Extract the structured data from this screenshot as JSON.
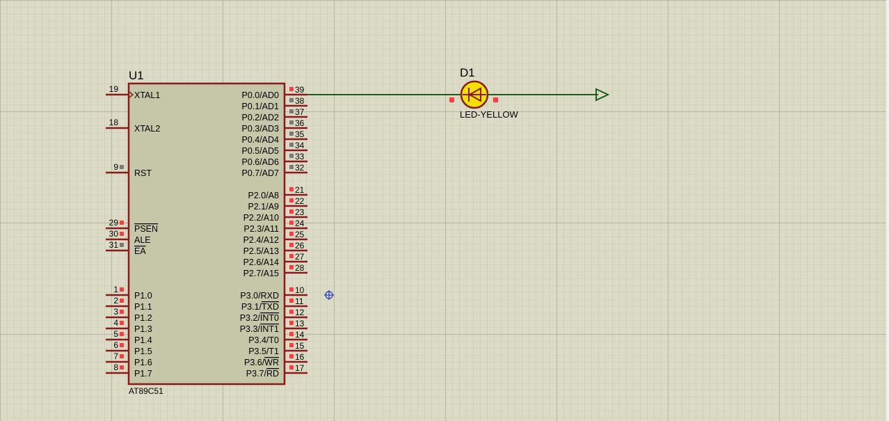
{
  "colors": {
    "background": "#dcdcc6",
    "grid_minor": "#c9c9b6",
    "grid_major": "#b9b9a8",
    "chip_fill": "#c6c6a8",
    "chip_outline": "#8b1a1a",
    "pin_line": "#8b1a1a",
    "wire": "#1e5c1e",
    "pin_marker_red": "#ff3b3b",
    "pin_marker_grey": "#7a7a7a",
    "led_fill": "#f5e100",
    "text": "#000000",
    "origin_marker": "#2233cc"
  },
  "schematic": {
    "u1": {
      "ref": "U1",
      "part": "AT89C51",
      "left_pins": [
        {
          "num": "19",
          "name": "XTAL1",
          "clock": true,
          "marker": "none"
        },
        {
          "num": "18",
          "name": "XTAL2",
          "marker": "none"
        },
        {
          "num": "9",
          "name": "RST",
          "marker": "grey"
        },
        {
          "num": "29",
          "name": "PSEN",
          "overline": true,
          "marker": "red"
        },
        {
          "num": "30",
          "name": "ALE",
          "marker": "red"
        },
        {
          "num": "31",
          "name": "EA",
          "overline": true,
          "marker": "grey"
        },
        {
          "num": "1",
          "name": "P1.0",
          "marker": "red"
        },
        {
          "num": "2",
          "name": "P1.1",
          "marker": "red"
        },
        {
          "num": "3",
          "name": "P1.2",
          "marker": "red"
        },
        {
          "num": "4",
          "name": "P1.3",
          "marker": "red"
        },
        {
          "num": "5",
          "name": "P1.4",
          "marker": "red"
        },
        {
          "num": "6",
          "name": "P1.5",
          "marker": "red"
        },
        {
          "num": "7",
          "name": "P1.6",
          "marker": "red"
        },
        {
          "num": "8",
          "name": "P1.7",
          "marker": "red"
        }
      ],
      "right_pins": [
        {
          "num": "39",
          "name": "P0.0/AD0",
          "marker": "red"
        },
        {
          "num": "38",
          "name": "P0.1/AD1",
          "marker": "grey"
        },
        {
          "num": "37",
          "name": "P0.2/AD2",
          "marker": "grey"
        },
        {
          "num": "36",
          "name": "P0.3/AD3",
          "marker": "grey"
        },
        {
          "num": "35",
          "name": "P0.4/AD4",
          "marker": "grey"
        },
        {
          "num": "34",
          "name": "P0.5/AD5",
          "marker": "grey"
        },
        {
          "num": "33",
          "name": "P0.6/AD6",
          "marker": "grey"
        },
        {
          "num": "32",
          "name": "P0.7/AD7",
          "marker": "grey"
        },
        {
          "num": "21",
          "name": "P2.0/A8",
          "marker": "red"
        },
        {
          "num": "22",
          "name": "P2.1/A9",
          "marker": "red"
        },
        {
          "num": "23",
          "name": "P2.2/A10",
          "marker": "red"
        },
        {
          "num": "24",
          "name": "P2.3/A11",
          "marker": "red"
        },
        {
          "num": "25",
          "name": "P2.4/A12",
          "marker": "red"
        },
        {
          "num": "26",
          "name": "P2.5/A13",
          "marker": "red"
        },
        {
          "num": "27",
          "name": "P2.6/A14",
          "marker": "red"
        },
        {
          "num": "28",
          "name": "P2.7/A15",
          "marker": "red"
        },
        {
          "num": "10",
          "name": "P3.0/RXD",
          "marker": "red"
        },
        {
          "num": "11",
          "name": "P3.1/",
          "suffix": "TXD",
          "marker": "red"
        },
        {
          "num": "12",
          "name": "P3.2/",
          "suffix": "INT0",
          "marker": "red"
        },
        {
          "num": "13",
          "name": "P3.3/",
          "suffix": "INT1",
          "marker": "red"
        },
        {
          "num": "14",
          "name": "P3.4/T0",
          "marker": "red"
        },
        {
          "num": "15",
          "name": "P3.5/T1",
          "marker": "red"
        },
        {
          "num": "16",
          "name": "P3.6/",
          "suffix": "WR",
          "marker": "red"
        },
        {
          "num": "17",
          "name": "P3.7/",
          "suffix": "RD",
          "marker": "red"
        }
      ]
    },
    "d1": {
      "ref": "D1",
      "part": "LED-YELLOW"
    }
  }
}
